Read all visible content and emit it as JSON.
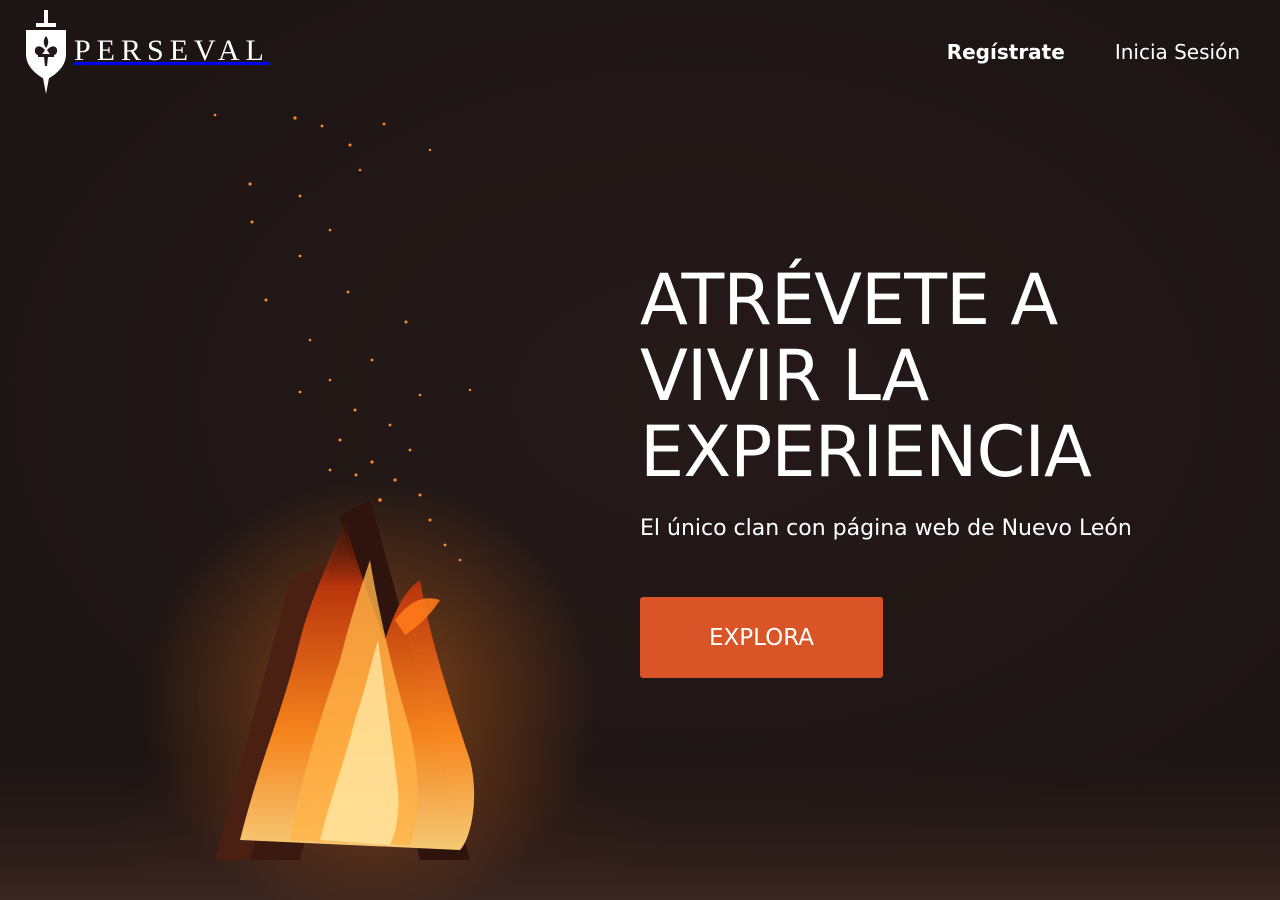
{
  "brand": {
    "name": "PERSEVAL",
    "icon": "shield-sword-fleur-de-lis-icon"
  },
  "nav": {
    "register_label": "Regístrate",
    "login_label": "Inicia Sesión"
  },
  "hero": {
    "title_lines": [
      "ATRÉVETE A",
      "VIVIR LA",
      "EXPERIENCIA"
    ],
    "subtitle": "El único clan con página web de Nuevo León",
    "cta_label": "EXPLORA"
  },
  "colors": {
    "background": "#211817",
    "accent": "#d95426",
    "text": "#ffffff"
  },
  "background_image": "campfire-at-night"
}
